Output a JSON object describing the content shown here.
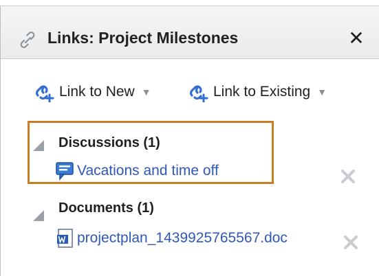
{
  "dialog": {
    "title": "Links: Project Milestones",
    "close_label": "✕"
  },
  "toolbar": {
    "link_to_new": "Link to New",
    "link_to_existing": "Link to Existing"
  },
  "groups": [
    {
      "title": "Discussions (1)",
      "items": [
        {
          "label": "Vacations and time off",
          "icon": "discussion-icon"
        }
      ]
    },
    {
      "title": "Documents (1)",
      "items": [
        {
          "label": "projectplan_1439925765567.doc",
          "icon": "word-document-icon"
        }
      ]
    }
  ],
  "colors": {
    "link": "#2f58b6",
    "highlight": "#c77d24",
    "add_link_icon": "#2f6fd0"
  }
}
